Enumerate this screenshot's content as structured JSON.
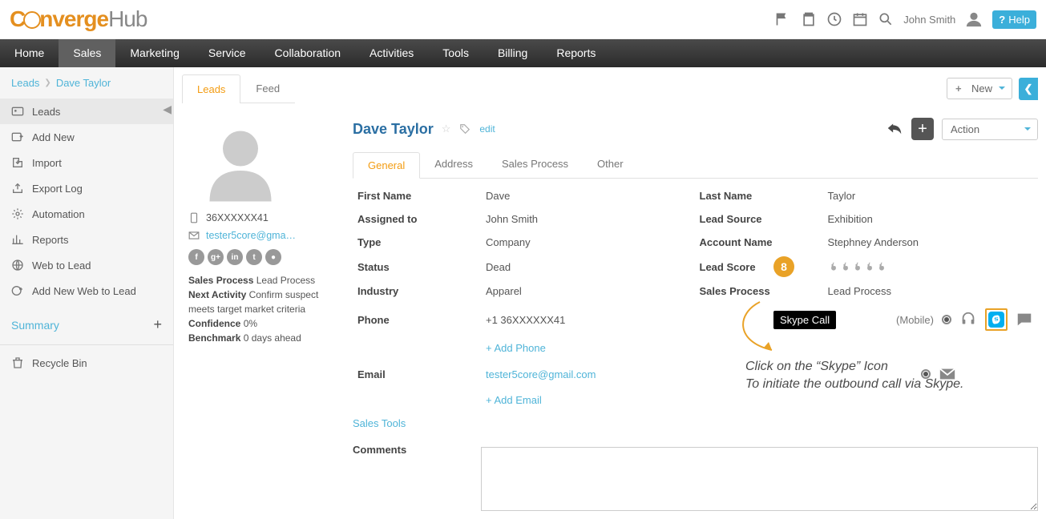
{
  "top": {
    "logo_left": "C",
    "logo_mid": "nverge",
    "logo_right": "Hub",
    "user": "John Smith",
    "help": "Help"
  },
  "nav": [
    "Home",
    "Sales",
    "Marketing",
    "Service",
    "Collaboration",
    "Activities",
    "Tools",
    "Billing",
    "Reports"
  ],
  "nav_active": 1,
  "breadcrumb": [
    "Leads",
    "Dave Taylor"
  ],
  "sidebar": {
    "items": [
      "Leads",
      "Add New",
      "Import",
      "Export Log",
      "Automation",
      "Reports",
      "Web to Lead",
      "Add New Web to Lead"
    ],
    "summary": "Summary",
    "recycle": "Recycle Bin"
  },
  "head": {
    "tabs": [
      "Leads",
      "Feed"
    ],
    "tabs_active": 0,
    "new_btn": "New"
  },
  "profile": {
    "phone": "36XXXXXX41",
    "email": "tester5core@gma…",
    "sales_process_label": "Sales Process",
    "sales_process_value": "Lead Process",
    "next_activity_label": "Next Activity",
    "next_activity_value": "Confirm suspect meets target market criteria",
    "confidence_label": "Confidence",
    "confidence_value": "0%",
    "benchmark_label": "Benchmark",
    "benchmark_value": "0 days ahead"
  },
  "record": {
    "title": "Dave Taylor",
    "edit": "edit",
    "action": "Action",
    "detail_tabs": [
      "General",
      "Address",
      "Sales Process",
      "Other"
    ],
    "detail_active": 0,
    "fields": {
      "first_name_l": "First Name",
      "first_name_v": "Dave",
      "last_name_l": "Last Name",
      "last_name_v": "Taylor",
      "assigned_l": "Assigned to",
      "assigned_v": "John Smith",
      "lead_source_l": "Lead Source",
      "lead_source_v": "Exhibition",
      "type_l": "Type",
      "type_v": "Company",
      "account_l": "Account Name",
      "account_v": "Stephney Anderson",
      "status_l": "Status",
      "status_v": "Dead",
      "score_l": "Lead Score",
      "industry_l": "Industry",
      "industry_v": "Apparel",
      "sproc_l": "Sales Process",
      "sproc_v": "Lead Process",
      "phone_l": "Phone",
      "phone_v": "+1 36XXXXXX41",
      "phone_type": "(Mobile)",
      "add_phone": "+ Add Phone",
      "email_l": "Email",
      "email_v": "tester5core@gmail.com",
      "add_email": "+ Add Email",
      "sales_tools": "Sales Tools",
      "comments_l": "Comments"
    }
  },
  "anno": {
    "num": "8",
    "tooltip": "Skype Call",
    "text1": "Click on the “Skype” Icon",
    "text2": "To initiate the outbound call via Skype."
  }
}
